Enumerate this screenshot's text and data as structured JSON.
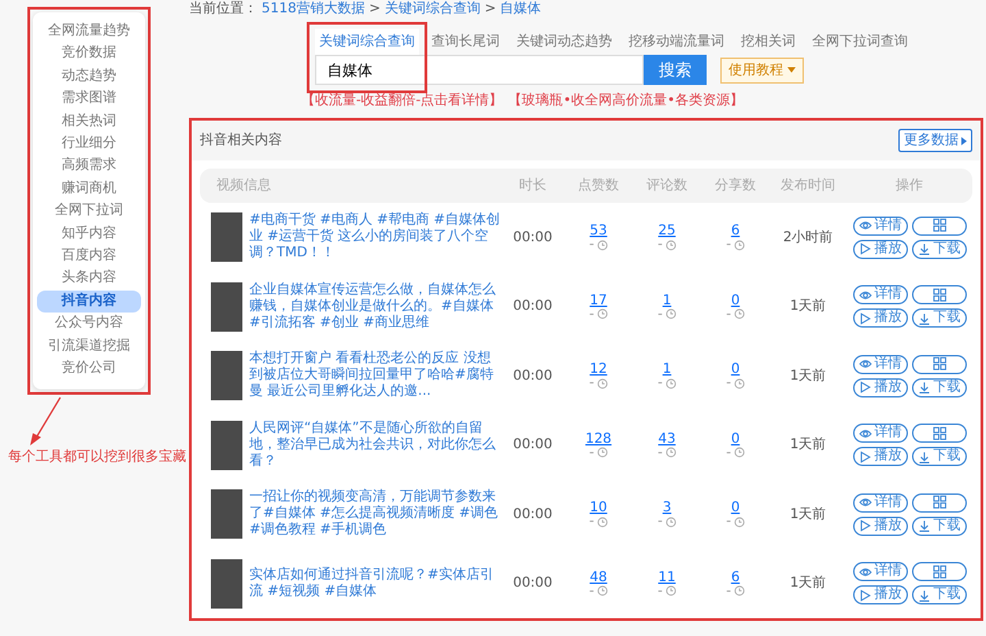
{
  "breadcrumb": {
    "label": "当前位置：",
    "separator": ">",
    "items": [
      "5118营销大数据",
      "关键词综合查询",
      "自媒体"
    ]
  },
  "sidebar": {
    "items": [
      {
        "label": "全网流量趋势",
        "selected": false
      },
      {
        "label": "竞价数据",
        "selected": false
      },
      {
        "label": "动态趋势",
        "selected": false
      },
      {
        "label": "需求图谱",
        "selected": false
      },
      {
        "label": "相关热词",
        "selected": false
      },
      {
        "label": "行业细分",
        "selected": false
      },
      {
        "label": "高频需求",
        "selected": false
      },
      {
        "label": "赚词商机",
        "selected": false
      },
      {
        "label": "全网下拉词",
        "selected": false
      },
      {
        "label": "知乎内容",
        "selected": false
      },
      {
        "label": "百度内容",
        "selected": false
      },
      {
        "label": "头条内容",
        "selected": false
      },
      {
        "label": "抖音内容",
        "selected": true
      },
      {
        "label": "公众号内容",
        "selected": false
      },
      {
        "label": "引流渠道挖掘",
        "selected": false
      },
      {
        "label": "竞价公司",
        "selected": false
      }
    ]
  },
  "annotation": "每个工具都可以挖到很多宝藏",
  "search": {
    "tabs": [
      {
        "label": "关键词综合查询",
        "selected": true
      },
      {
        "label": "查询长尾词",
        "selected": false
      },
      {
        "label": "关键词动态趋势",
        "selected": false
      },
      {
        "label": "挖移动端流量词",
        "selected": false
      },
      {
        "label": "挖相关词",
        "selected": false
      },
      {
        "label": "全网下拉词查询",
        "selected": false
      }
    ],
    "value": "自媒体",
    "button": "搜索",
    "help": "使用教程",
    "links": [
      "【收流量-收益翻倍-点击看详情】",
      "【玻璃瓶•收全网高价流量•各类资源】"
    ]
  },
  "card": {
    "title": "抖音相关内容",
    "more": "更多数据",
    "columns": [
      "视频信息",
      "时长",
      "点赞数",
      "评论数",
      "分享数",
      "发布时间",
      "操作"
    ],
    "rows": [
      {
        "title": "#电商干货 #电商人 #帮电商 #自媒体创业 #运营干货 这么小的房间装了八个空调？TMD！！",
        "duration": "00:00",
        "stats": [
          {
            "value": "53",
            "sub": "-"
          },
          {
            "value": "25",
            "sub": "-"
          },
          {
            "value": "6",
            "sub": "-"
          }
        ],
        "time": "2小时前",
        "actions": [
          "详情",
          "播放",
          "下载"
        ]
      },
      {
        "title": "企业自媒体宣传运营怎么做，自媒体怎么赚钱，自媒体创业是做什么的。#自媒体 #引流拓客 #创业 #商业思维",
        "duration": "00:00",
        "stats": [
          {
            "value": "17",
            "sub": "-"
          },
          {
            "value": "1",
            "sub": "-"
          },
          {
            "value": "0",
            "sub": "-"
          }
        ],
        "time": "1天前",
        "actions": [
          "详情",
          "播放",
          "下载"
        ]
      },
      {
        "title": "本想打开窗户 看看杜恐老公的反应 没想到被店位大哥瞬间拉回量甲了哈哈#腐特曼 最近公司里孵化达人的邀...",
        "duration": "00:00",
        "stats": [
          {
            "value": "12",
            "sub": "-"
          },
          {
            "value": "1",
            "sub": "-"
          },
          {
            "value": "0",
            "sub": "-"
          }
        ],
        "time": "1天前",
        "actions": [
          "详情",
          "播放",
          "下载"
        ]
      },
      {
        "title": "人民网评“自媒体”不是随心所欲的自留地，整治早已成为社会共识，对此你怎么看？",
        "duration": "00:00",
        "stats": [
          {
            "value": "128",
            "sub": "-"
          },
          {
            "value": "43",
            "sub": "-"
          },
          {
            "value": "0",
            "sub": "-"
          }
        ],
        "time": "1天前",
        "actions": [
          "详情",
          "播放",
          "下载"
        ]
      },
      {
        "title": "一招让你的视频变高清，万能调节参数来了#自媒体 #怎么提高视频清晰度 #调色 #调色教程 #手机调色",
        "duration": "00:00",
        "stats": [
          {
            "value": "10",
            "sub": "-"
          },
          {
            "value": "3",
            "sub": "-"
          },
          {
            "value": "0",
            "sub": "-"
          }
        ],
        "time": "1天前",
        "actions": [
          "详情",
          "播放",
          "下载"
        ]
      },
      {
        "title": "实体店如何通过抖音引流呢？#实体店引流 #短视频 #自媒体",
        "duration": "00:00",
        "stats": [
          {
            "value": "48",
            "sub": "-"
          },
          {
            "value": "11",
            "sub": "-"
          },
          {
            "value": "6",
            "sub": "-"
          }
        ],
        "time": "1天前",
        "actions": [
          "详情",
          "播放",
          "下载"
        ]
      }
    ]
  }
}
